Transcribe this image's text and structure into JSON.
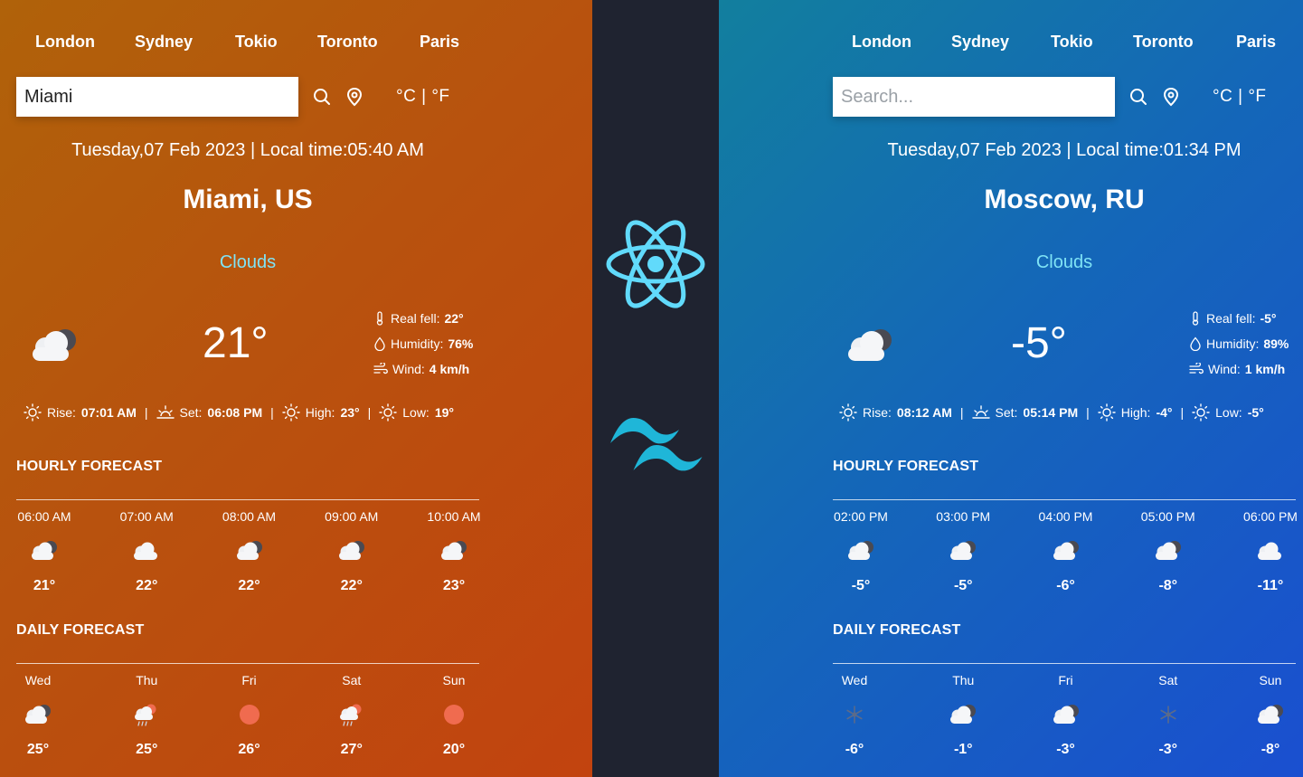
{
  "nav_cities": [
    "London",
    "Sydney",
    "Tokio",
    "Toronto",
    "Paris"
  ],
  "left": {
    "search": {
      "value": "Miami",
      "placeholder": "Search..."
    },
    "units_label": "°C | °F",
    "datetime": "Tuesday,07 Feb 2023 | Local time:05:40 AM",
    "city": "Miami, US",
    "condition": "Clouds",
    "temperature": "21°",
    "details": {
      "real_feel_label": "Real fell:",
      "real_feel": "22°",
      "humidity_label": "Humidity:",
      "humidity": "76%",
      "wind_label": "Wind:",
      "wind": "4 km/h"
    },
    "sun": {
      "rise_label": "Rise:",
      "rise": "07:01 AM",
      "set_label": "Set:",
      "set": "06:08 PM",
      "high_label": "High:",
      "high": "23°",
      "low_label": "Low:",
      "low": "19°"
    },
    "hourly_title": "HOURLY FORECAST",
    "hourly": [
      {
        "label": "06:00 AM",
        "temp": "21°",
        "icon": "cloud-dark-icon"
      },
      {
        "label": "07:00 AM",
        "temp": "22°",
        "icon": "cloud-icon"
      },
      {
        "label": "08:00 AM",
        "temp": "22°",
        "icon": "cloud-dark-icon"
      },
      {
        "label": "09:00 AM",
        "temp": "22°",
        "icon": "cloud-dark-icon"
      },
      {
        "label": "10:00 AM",
        "temp": "23°",
        "icon": "cloud-dark-icon"
      }
    ],
    "daily_title": "DAILY FORECAST",
    "daily": [
      {
        "label": "Wed",
        "temp": "25°",
        "icon": "cloud-dark-icon"
      },
      {
        "label": "Thu",
        "temp": "25°",
        "icon": "cloud-rain-sun-icon"
      },
      {
        "label": "Fri",
        "temp": "26°",
        "icon": "sun-icon"
      },
      {
        "label": "Sat",
        "temp": "27°",
        "icon": "cloud-rain-sun-icon"
      },
      {
        "label": "Sun",
        "temp": "20°",
        "icon": "sun-icon"
      }
    ]
  },
  "right": {
    "search": {
      "value": "",
      "placeholder": "Search..."
    },
    "units_label": "°C | °F",
    "datetime": "Tuesday,07 Feb 2023 | Local time:01:34 PM",
    "city": "Moscow, RU",
    "condition": "Clouds",
    "temperature": "-5°",
    "details": {
      "real_feel_label": "Real fell:",
      "real_feel": "-5°",
      "humidity_label": "Humidity:",
      "humidity": "89%",
      "wind_label": "Wind:",
      "wind": "1 km/h"
    },
    "sun": {
      "rise_label": "Rise:",
      "rise": "08:12 AM",
      "set_label": "Set:",
      "set": "05:14 PM",
      "high_label": "High:",
      "high": "-4°",
      "low_label": "Low:",
      "low": "-5°"
    },
    "hourly_title": "HOURLY FORECAST",
    "hourly": [
      {
        "label": "02:00 PM",
        "temp": "-5°",
        "icon": "cloud-dark-icon"
      },
      {
        "label": "03:00 PM",
        "temp": "-5°",
        "icon": "cloud-dark-icon"
      },
      {
        "label": "04:00 PM",
        "temp": "-6°",
        "icon": "cloud-dark-icon"
      },
      {
        "label": "05:00 PM",
        "temp": "-8°",
        "icon": "cloud-dark-icon"
      },
      {
        "label": "06:00 PM",
        "temp": "-11°",
        "icon": "cloud-icon"
      }
    ],
    "daily_title": "DAILY FORECAST",
    "daily": [
      {
        "label": "Wed",
        "temp": "-6°",
        "icon": "snowflake-icon"
      },
      {
        "label": "Thu",
        "temp": "-1°",
        "icon": "cloud-dark-icon"
      },
      {
        "label": "Fri",
        "temp": "-3°",
        "icon": "cloud-dark-icon"
      },
      {
        "label": "Sat",
        "temp": "-3°",
        "icon": "snowflake-icon"
      },
      {
        "label": "Sun",
        "temp": "-8°",
        "icon": "cloud-dark-icon"
      }
    ]
  },
  "center": {
    "top_logo": "react-logo-icon",
    "bottom_logo": "tailwind-logo-icon"
  },
  "colors": {
    "condition": "#7fe3f5",
    "center_bg": "#1f2330",
    "react_logo": "#61dafb",
    "tailwind_logo": "#38bdf8",
    "sun": "#f06b4f"
  }
}
